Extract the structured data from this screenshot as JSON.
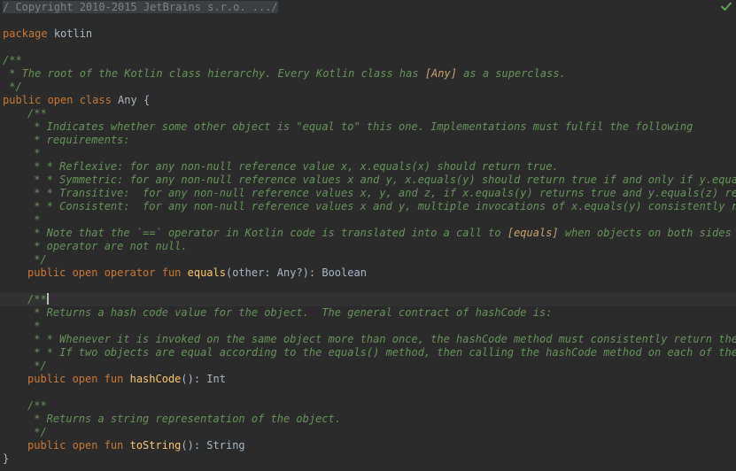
{
  "editor": {
    "status_icon": "check-icon",
    "lines": {
      "l01": "/ Copyright 2010-2015 JetBrains s.r.o. .../",
      "l03a": "package",
      "l03b": "kotlin",
      "l05": "/**",
      "l06a": " * The root of the Kotlin class hierarchy. Every Kotlin class has ",
      "l06b": "[Any]",
      "l06c": " as a superclass.",
      "l07": " */",
      "l08a": "public open class",
      "l08b": " Any {",
      "l09": "/**",
      "l10": " * Indicates whether some other object is \"equal to\" this one. Implementations must fulfil the following",
      "l11": " * requirements:",
      "l12": " *",
      "l13": " * * Reflexive: for any non-null reference value x, x.equals(x) should return true.",
      "l14": " * * Symmetric: for any non-null reference values x and y, x.equals(y) should return true if and only if y.equals(x",
      "l15": " * * Transitive:  for any non-null reference values x, y, and z, if x.equals(y) returns true and y.equals(z) return",
      "l16": " * * Consistent:  for any non-null reference values x and y, multiple invocations of x.equals(y) consistently retu",
      "l17": " *",
      "l18a": " * Note that the `==` operator in Kotlin code is translated into a call to ",
      "l18b": "[equals]",
      "l18c": " when objects on both sides of t",
      "l19": " * operator are not null.",
      "l20": " */",
      "l21a": "public open operator fun",
      "l21b": "equals",
      "l21c": "(other: Any?): Boolean",
      "l23": "/**",
      "l24": " * Returns a hash code value for the object.  The general contract of hashCode is:",
      "l25": " *",
      "l26": " * * Whenever it is invoked on the same object more than once, the hashCode method must consistently return the sam",
      "l27": " * * If two objects are equal according to the equals() method, then calling the hashCode method on each of the two",
      "l28": " */",
      "l29a": "public open fun",
      "l29b": "hashCode",
      "l29c": "(): Int",
      "l31": "/**",
      "l32": " * Returns a string representation of the object.",
      "l33": " */",
      "l34a": "public open fun",
      "l34b": "toString",
      "l34c": "(): String",
      "l35": "}"
    }
  },
  "colors": {
    "background": "#2b2b2b",
    "current_line": "#323232",
    "keyword": "#cc7832",
    "function": "#ffc66d",
    "doc_comment": "#629755",
    "doc_link": "#d0a16b",
    "plain": "#a9b7c6",
    "check": "#5aa64f"
  }
}
